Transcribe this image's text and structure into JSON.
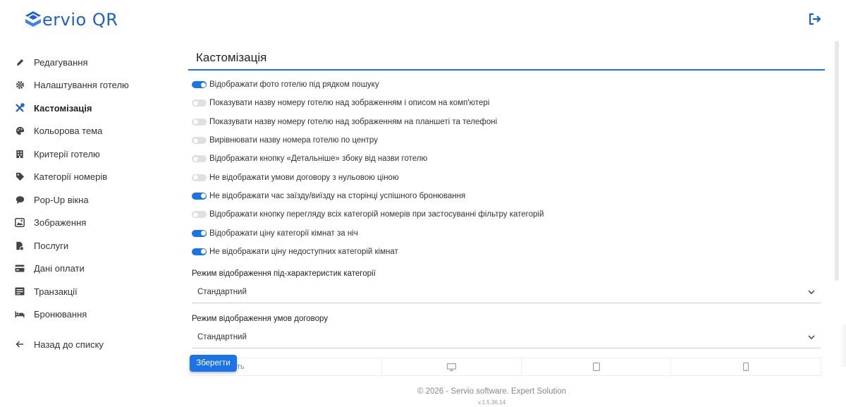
{
  "app": {
    "logo_text": "ervio QR"
  },
  "colors": {
    "accent": "#1a73e8",
    "logo": "#1a5fd6"
  },
  "sidebar": {
    "items": [
      {
        "label": "Редагування",
        "icon": "pencil-icon",
        "active": false
      },
      {
        "label": "Налаштування готелю",
        "icon": "gear-icon",
        "active": false
      },
      {
        "label": "Кастомізація",
        "icon": "tools-icon",
        "active": true
      },
      {
        "label": "Кольорова тема",
        "icon": "palette-icon",
        "active": false
      },
      {
        "label": "Критерії готелю",
        "icon": "building-icon",
        "active": false
      },
      {
        "label": "Категорії номерів",
        "icon": "tag-icon",
        "active": false
      },
      {
        "label": "Pop-Up вікна",
        "icon": "comment-icon",
        "active": false
      },
      {
        "label": "Зображення",
        "icon": "image-icon",
        "active": false
      },
      {
        "label": "Послуги",
        "icon": "file-icon",
        "active": false
      },
      {
        "label": "Дані оплати",
        "icon": "card-icon",
        "active": false
      },
      {
        "label": "Транзакції",
        "icon": "receipt-icon",
        "active": false
      },
      {
        "label": "Бронювання",
        "icon": "bed-icon",
        "active": false
      }
    ],
    "back": {
      "label": "Назад до списку",
      "icon": "arrow-left-icon"
    }
  },
  "main": {
    "title": "Кастомізація",
    "options": [
      {
        "label": "Відображати фото готелю під рядком пошуку",
        "on": true
      },
      {
        "label": "Показувати назву номеру готелю над зображенням і описом на комп'ютері",
        "on": false
      },
      {
        "label": "Показувати назву номеру готелю над зображенням на планшеті та телефоні",
        "on": false
      },
      {
        "label": "Вирівнювати назву номера готелю по центру",
        "on": false
      },
      {
        "label": "Відображати кнопку «Детальніше» збоку від назви готелю",
        "on": false
      },
      {
        "label": "Не відображати умови договору з нульовою ціною",
        "on": false
      },
      {
        "label": "Не відображати час заїзду/виїзду на сторінці успішного бронювання",
        "on": true
      },
      {
        "label": "Відображати кнопку перегляду всіх категорій номерів при застосуванні фільтру категорій",
        "on": false
      },
      {
        "label": "Відображати ціну категорії кімнат за ніч",
        "on": true
      },
      {
        "label": "Не відображати ціну недоступних категорій кімнат",
        "on": true
      }
    ],
    "selects": [
      {
        "label": "Режим відображення під-характеристик категорії",
        "value": "Стандартний"
      },
      {
        "label": "Режим відображення умов договору",
        "value": "Стандартний"
      }
    ],
    "preview_text": "ть",
    "save_label": "Зберегти"
  },
  "footer": {
    "copyright": "© 2026 - Servio software. Expert Solution",
    "version": "v.1.5.36.14"
  }
}
